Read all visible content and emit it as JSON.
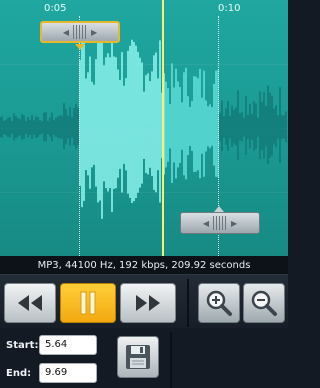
{
  "timeline": {
    "ticks": [
      "0:05",
      "0:10"
    ]
  },
  "audio_info": "MP3, 44100 Hz, 192 kbps, 209.92 seconds",
  "controls": {
    "rewind_icon": "rewind-icon",
    "pause_icon": "pause-icon",
    "forward_icon": "fast-forward-icon",
    "zoom_in_icon": "zoom-in-icon",
    "zoom_out_icon": "zoom-out-icon",
    "accent_color": "#f3a90f"
  },
  "selection": {
    "start_label": "Start:",
    "start_value": "5.64",
    "end_label": "End:",
    "end_value": "9.69"
  },
  "save_icon": "save-icon"
}
